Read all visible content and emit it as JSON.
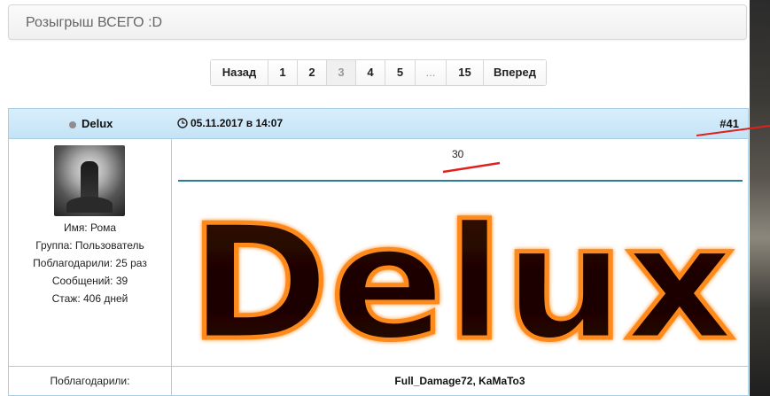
{
  "topic": {
    "title": "Розыгрыш ВСЕГО :D"
  },
  "pagination": {
    "prev": "Назад",
    "pages": [
      "1",
      "2",
      "3",
      "4",
      "5",
      "...",
      "15"
    ],
    "current": "3",
    "next": "Вперед"
  },
  "post": {
    "author": "Delux",
    "date": "05.11.2017 в 14:07",
    "number": "#41",
    "message": "30",
    "signature_text": "Delux",
    "user": {
      "name_line": "Имя: Рома",
      "group_line": "Группа: Пользователь",
      "thanks_line": "Поблагодарили: 25 раз",
      "posts_line": "Сообщений: 39",
      "tenure_line": "Стаж: 406 дней"
    },
    "thanks": {
      "label": "Поблагодарили:",
      "names": "Full_Damage72, KaMaTo3"
    }
  },
  "colors": {
    "header_bg": "#c4e3f6",
    "border": "#a8cde6",
    "separator": "#2c7a9c",
    "annotation": "#e0201c",
    "signature_fire": "#ff8a1c"
  },
  "icons": {
    "online_status": "status-dot-icon",
    "post_time": "clock-icon"
  }
}
